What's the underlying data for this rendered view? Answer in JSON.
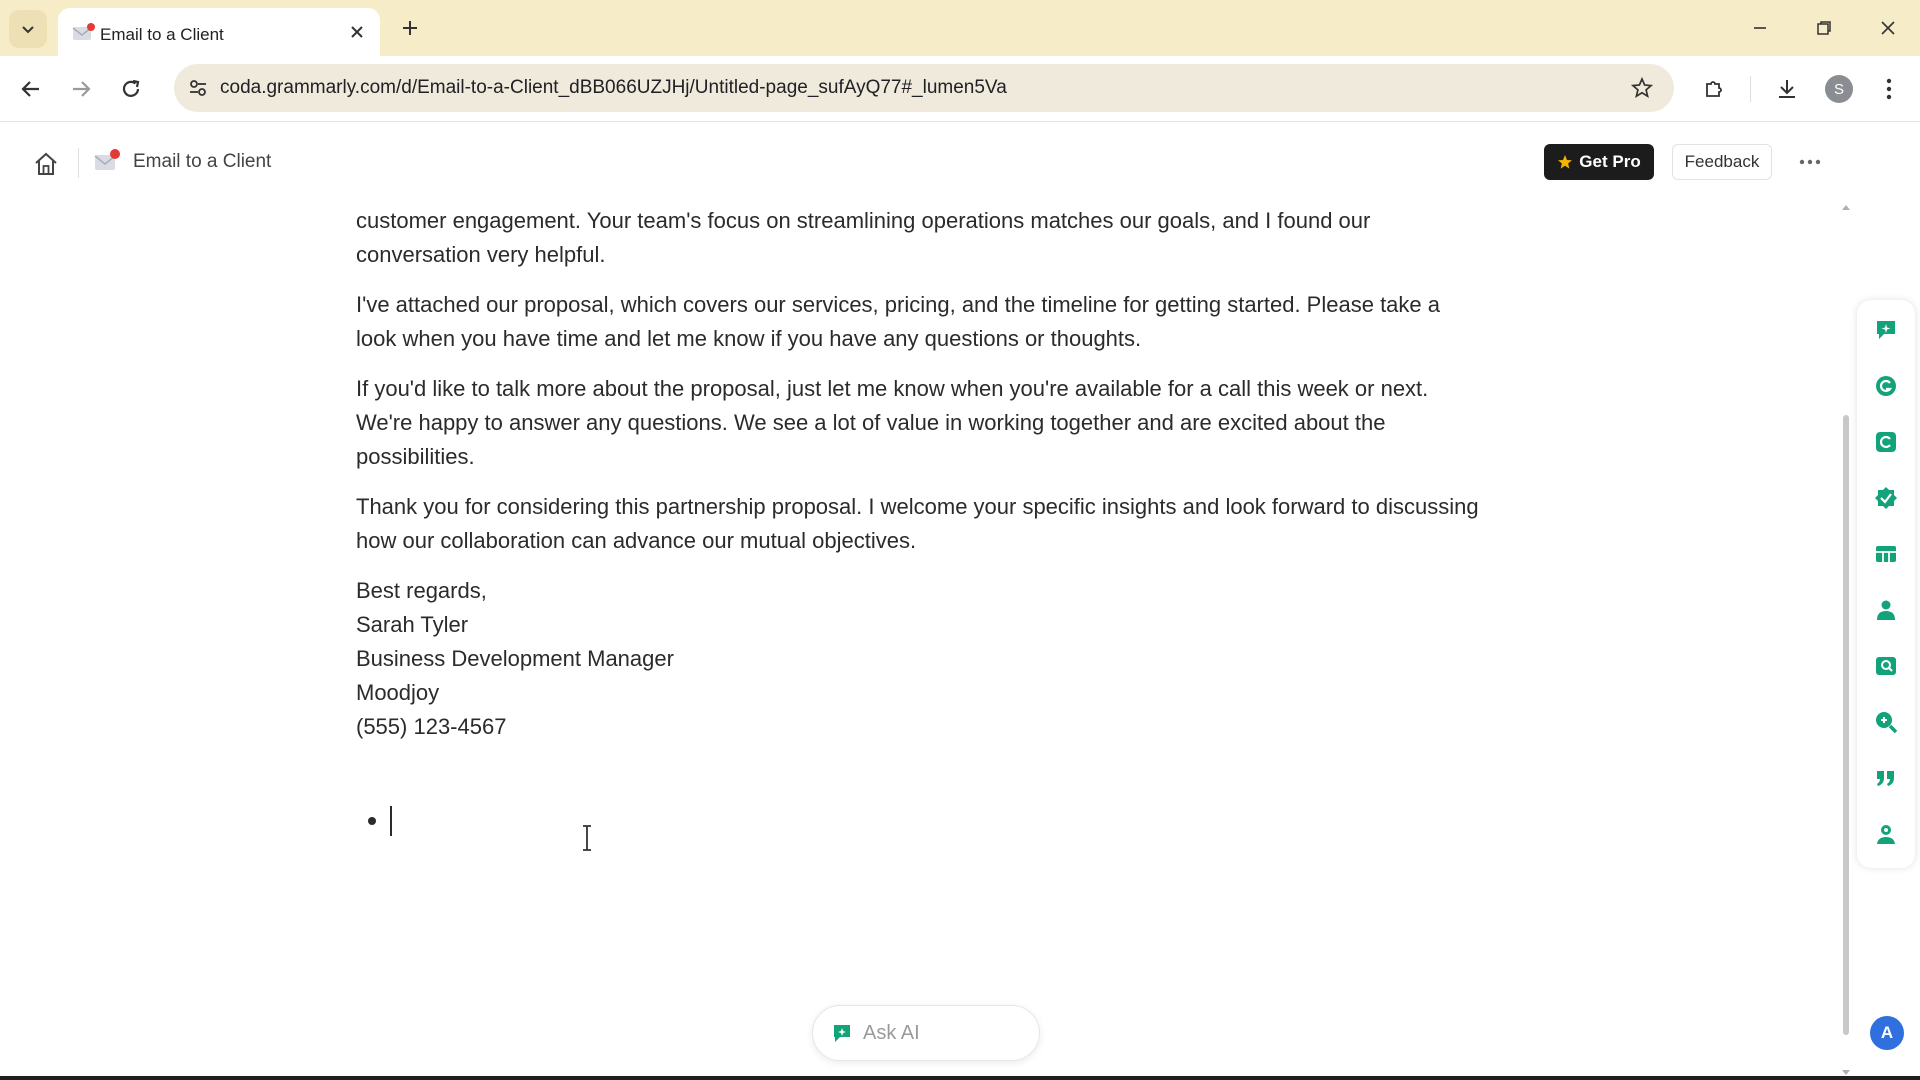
{
  "browser": {
    "tab_title": "Email to a Client",
    "url": "coda.grammarly.com/d/Email-to-a-Client_dBB066UZJHj/Untitled-page_sufAyQ77#_lumen5Va",
    "profile_initial": "S"
  },
  "header": {
    "doc_title": "Email to a Client",
    "get_pro_label": "Get Pro",
    "feedback_label": "Feedback"
  },
  "document": {
    "paragraphs": [
      "your team. I really valued your thoughts on digital transformation, especially your ideas for using AI to boost customer engagement. Your team's focus on streamlining operations matches our goals, and I found our conversation very helpful.",
      "I've attached our proposal, which covers our services, pricing, and the timeline for getting started. Please take a look when you have time and let me know if you have any questions or thoughts.",
      "If you'd like to talk more about the proposal, just let me know when you're available for a call this week or next. We're happy to answer any questions. We see a lot of value in working together and are excited about the possibilities.",
      "Thank you for considering this partnership proposal. I welcome your specific insights and look forward to discussing how our collaboration can advance our mutual objectives."
    ],
    "signature": {
      "closing": "Best regards,",
      "name": "Sarah Tyler",
      "role": "Business Development Manager",
      "company": "Moodjoy",
      "phone": "(555) 123-4567"
    }
  },
  "ask_ai": {
    "label": "Ask AI"
  },
  "rail_icons": [
    "ai-chat-icon",
    "grammarly-icon",
    "rewrite-icon",
    "check-badge-icon",
    "table-icon",
    "person-icon",
    "image-search-icon",
    "zoom-icon",
    "quote-icon",
    "user-badge-icon"
  ],
  "assistant_avatar": "A",
  "colors": {
    "accent": "#13a37a",
    "tabbar": "#f6ecc8",
    "get_pro_bg": "#1c1c1c",
    "star": "#f5b400"
  }
}
